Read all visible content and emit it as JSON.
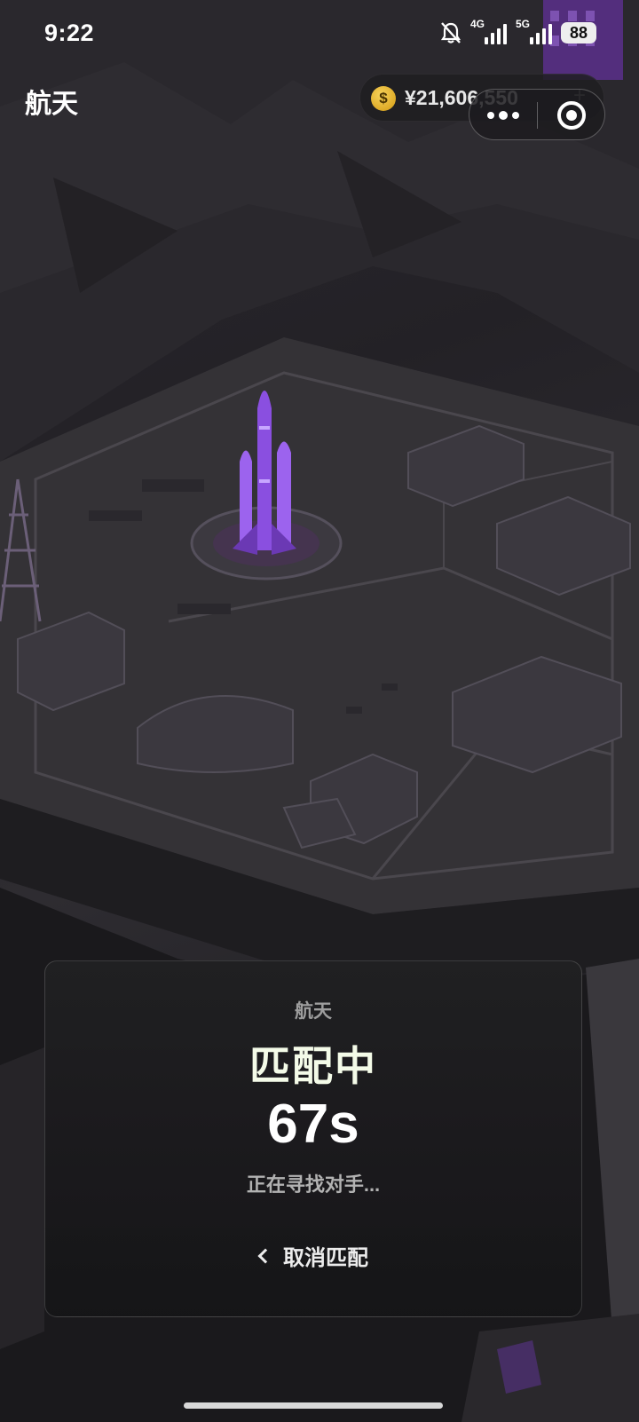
{
  "status_bar": {
    "time": "9:22",
    "network_1": "4G",
    "network_2": "5G",
    "battery": "88"
  },
  "header": {
    "title": "航天",
    "balance": "¥21,606,550",
    "add_symbol": "+"
  },
  "match_card": {
    "mode": "航天",
    "status": "匹配中",
    "timer": "67s",
    "hint": "正在寻找对手...",
    "cancel_label": "取消匹配"
  },
  "icons": {
    "mute": "bell-off-icon",
    "coin": "dollar-coin-icon",
    "more": "more-dots-icon",
    "close": "target-circle-icon",
    "back": "chevron-left-icon"
  },
  "colors": {
    "accent_purple": "#8a4fe0",
    "coin_gold": "#e1b22a",
    "status_text": "#f4fbe8",
    "background": "#232126"
  }
}
